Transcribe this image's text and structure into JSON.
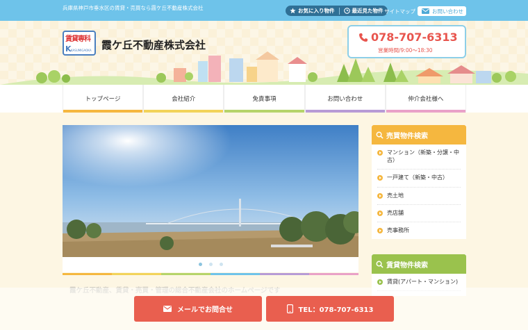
{
  "topbar": {
    "tagline": "兵庫県神戸市垂水区の賃貸・売買なら霞ケ丘不動産株式会社",
    "favorites_label": "お気に入り物件",
    "recent_label": "最近見た物件",
    "sitemap_label": "サイトマップ",
    "contact_label": "お問い合わせ"
  },
  "header": {
    "logo_line1": "賃貸専科",
    "logo_line2": "K",
    "logo_line3": "KASUMIGAOKA",
    "company_name": "霞ケ丘不動産株式会社",
    "phone": "078-707-6313",
    "hours": "営業時間/9:00〜18:30"
  },
  "nav": {
    "items": [
      {
        "label": "トップページ",
        "color": "#f5b73f"
      },
      {
        "label": "会社紹介",
        "color": "#f2d35a"
      },
      {
        "label": "免責事項",
        "color": "#b6d46a"
      },
      {
        "label": "お問い合わせ",
        "color": "#b79bd6"
      },
      {
        "label": "仲介会社様へ",
        "color": "#e9a1c8"
      }
    ]
  },
  "slider": {
    "slides": 3,
    "active_slide": 1
  },
  "welcome_text": "霞ケ丘不動産、賃貸・売買・管理の総合不動産会社のホームページです",
  "sidebar": {
    "sale": {
      "title": "売買物件検索",
      "items": [
        "マンション（新築・分譲・中古）",
        "一戸建て（新築・中古）",
        "売土地",
        "売店舗",
        "売事務所"
      ]
    },
    "rent": {
      "title": "賃貸物件検索",
      "items": [
        "賃貸(アパート・マンション)"
      ]
    }
  },
  "cta": {
    "mail_label": "メールでお問合せ",
    "tel_label": "TEL：078-707-6313"
  },
  "colors": {
    "top_blue": "#6ec3ea",
    "accent_orange": "#f5b73f",
    "accent_green": "#9ac24d",
    "phone_red": "#e8554e",
    "cta_red": "#e95f4f"
  }
}
